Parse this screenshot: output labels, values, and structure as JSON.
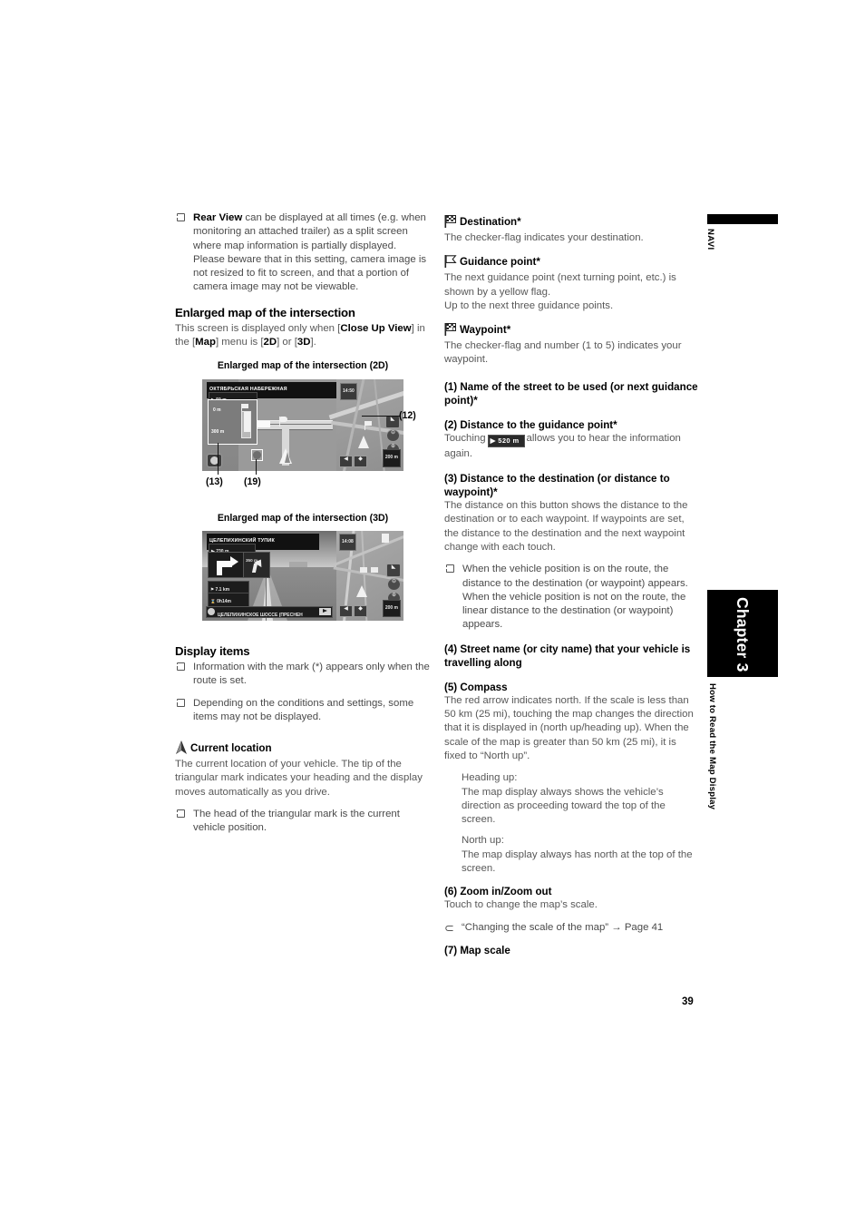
{
  "page": {
    "number": "39",
    "navi_tab_label": "NAVI",
    "chapter_tab_label": "Chapter 3",
    "chapter_subtitle": "How to Read the Map Display"
  },
  "left_column": {
    "rear_view_note_lead": "Rear View",
    "rear_view_note_rest": " can be displayed at all times (e.g. when monitoring an attached trailer) as a split screen where map information is partially displayed. Please beware that in this setting, camera image is not resized to fit to screen, and that a portion of camera image may not be viewable.",
    "enlarged_heading": "Enlarged map of the intersection",
    "enlarged_intro_1": "This screen is displayed only when [",
    "enlarged_intro_bold_1": "Close Up View",
    "enlarged_intro_2": "] in the [",
    "enlarged_intro_bold_2": "Map",
    "enlarged_intro_3": "] menu is [",
    "enlarged_intro_bold_3": "2D",
    "enlarged_intro_4": "] or [",
    "enlarged_intro_bold_4": "3D",
    "enlarged_intro_5": "].",
    "fig_2d_caption": "Enlarged map of the intersection (2D)",
    "fig_3d_caption": "Enlarged map of the intersection (3D)",
    "callouts": {
      "c12": "(12)",
      "c13": "(13)",
      "c19": "(19)"
    },
    "display_items_heading": "Display items",
    "display_items_bullets": [
      "Information with the mark (*) appears only when the route is set.",
      "Depending on the conditions and settings, some items may not be displayed."
    ],
    "current_location_heading": "Current location",
    "current_location_icon": "vehicle-arrow-icon",
    "current_location_body": "The current location of your vehicle. The tip of the triangular mark indicates your heading and the display moves automatically as you drive.",
    "current_location_bullet": "The head of the triangular mark is the current vehicle position."
  },
  "screens": {
    "map_2d": {
      "street_title": "ОКТЯБРЬСКАЯ НАБЕРЕЖНАЯ",
      "distance_chip": "50 m",
      "lane_top_label": "0 m",
      "lane_bottom_label": "300 m",
      "clock": "14:50",
      "scale_chip": "200 m"
    },
    "map_3d": {
      "street_title": "ЦЕЛЕПИХИНСКИЙ ТУПИК",
      "distance_chip": "230 m",
      "next_turn_chip": "350 m",
      "remaining_distance": "7.1 km",
      "remaining_time": "0h14m",
      "bottom_street": "ЦЕЛЕПИХИНСКОЕ ШОССЕ (ПРЕСНЕН",
      "clock": "14:08",
      "scale_chip": "200 m"
    }
  },
  "right_column": {
    "destination_heading": "Destination*",
    "destination_icon": "checkered-flag-icon",
    "destination_body": "The checker-flag indicates your destination.",
    "guidance_heading": "Guidance point*",
    "guidance_icon": "yellow-flag-icon",
    "guidance_body_1": "The next guidance point (next turning point, etc.) is shown by a yellow flag.",
    "guidance_body_2": "Up to the next three guidance points.",
    "waypoint_heading": "Waypoint*",
    "waypoint_icon": "checkered-flag-numbered-icon",
    "waypoint_body": "The checker-flag and number (1 to 5) indicates your waypoint.",
    "item1_heading": "(1) Name of the street to be used (or next guidance point)*",
    "item2_heading": "(2) Distance to the guidance point*",
    "item2_body_pre": "Touching",
    "item2_button_label": "520 m",
    "item2_body_post": "allows you to hear the information again.",
    "item3_heading": "(3) Distance to the destination (or distance to waypoint)*",
    "item3_body": "The distance on this button shows the distance to the destination or to each waypoint. If waypoints are set, the distance to the destination and the next waypoint change with each touch.",
    "item3_bullet": "When the vehicle position is on the route, the distance to the destination (or waypoint) appears. When the vehicle position is not on the route, the linear distance to the destination (or waypoint) appears.",
    "item4_heading": "(4) Street name (or city name) that your vehicle is travelling along",
    "item5_heading": "(5) Compass",
    "item5_body": "The red arrow indicates north. If the scale is less than 50 km (25 mi), touching the map changes the direction that it is displayed in (north up/heading up). When the scale of the map is greater than 50 km (25 mi), it is fixed to “North up”.",
    "heading_up_label": "Heading up:",
    "heading_up_body": "The map display always shows the vehicle’s direction as proceeding toward the top of the screen.",
    "north_up_label": "North up:",
    "north_up_body": "The map display always has north at the top of the screen.",
    "item6_heading": "(6) Zoom in/Zoom out",
    "item6_body": "Touch to change the map’s scale.",
    "item6_seealso": "“Changing the scale of the map” → Page 41",
    "item7_heading": "(7) Map scale"
  }
}
